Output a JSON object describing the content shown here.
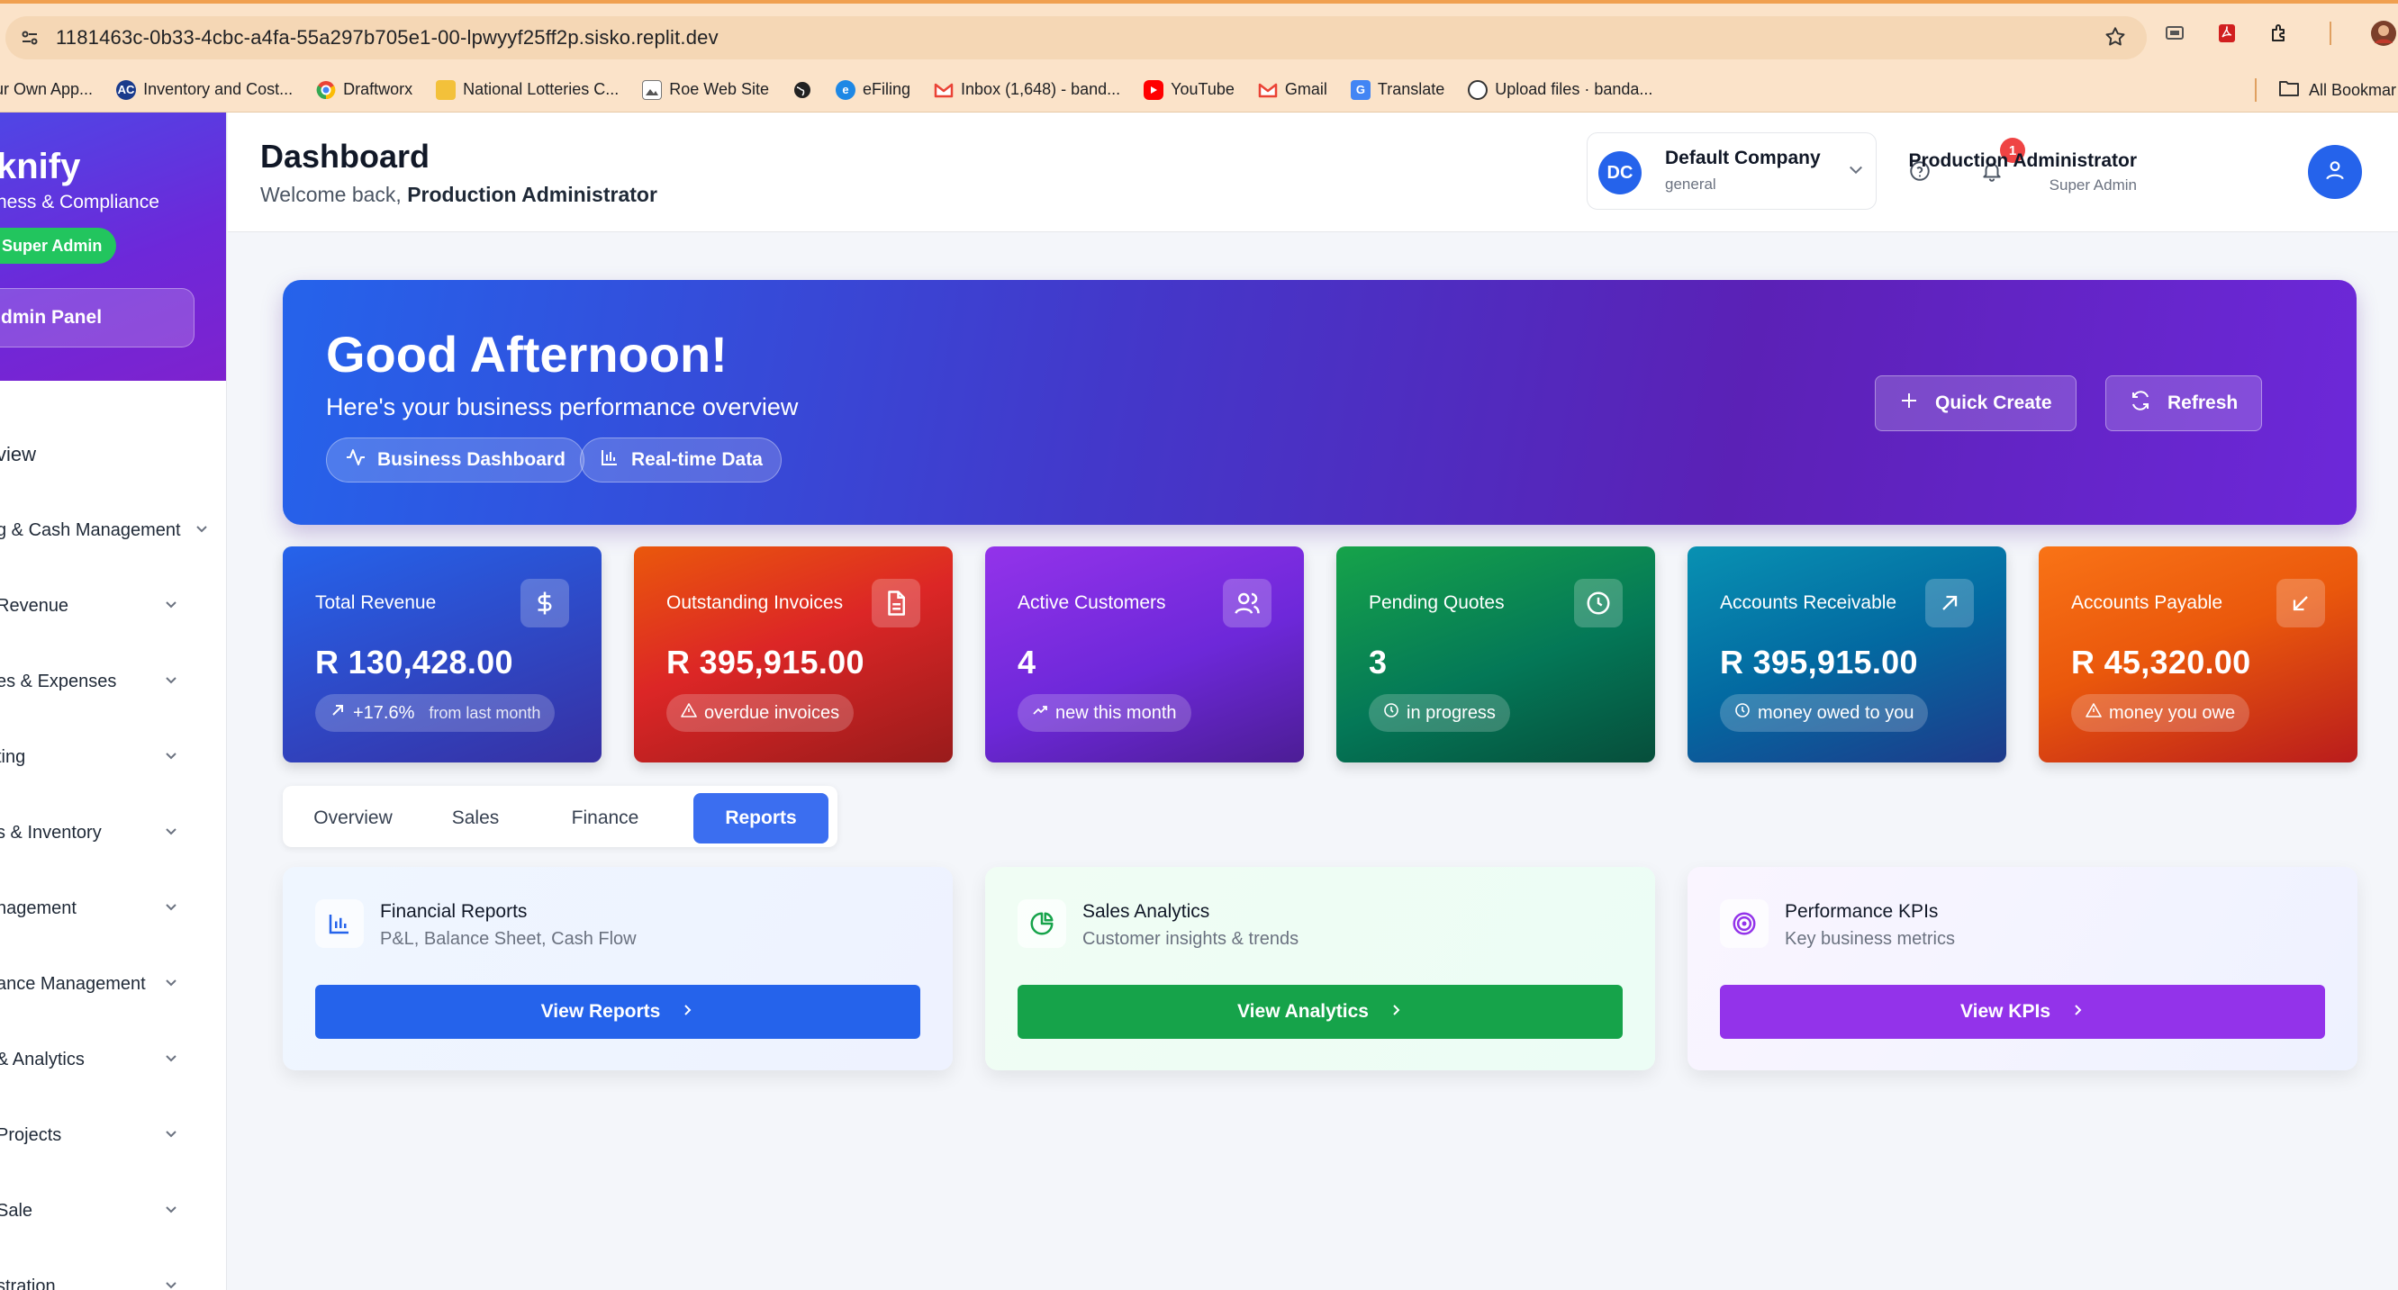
{
  "browser": {
    "url": "1181463c-0b33-4cbc-a4fa-55a297b705e1-00-lpwyyf25ff2p.sisko.replit.dev",
    "bookmarks": [
      {
        "label": "ur Own App...",
        "icon": "app-icon"
      },
      {
        "label": "Inventory and Cost...",
        "icon": "ac-icon"
      },
      {
        "label": "Draftworx",
        "icon": "chrome-icon"
      },
      {
        "label": "National Lotteries C...",
        "icon": "lotteries-icon"
      },
      {
        "label": "Roe Web Site",
        "icon": "image-icon"
      },
      {
        "label": "",
        "icon": "globe-icon"
      },
      {
        "label": "eFiling",
        "icon": "efiling-icon"
      },
      {
        "label": "Inbox (1,648) - band...",
        "icon": "gmail-icon"
      },
      {
        "label": "YouTube",
        "icon": "youtube-icon"
      },
      {
        "label": "Gmail",
        "icon": "gmail-icon"
      },
      {
        "label": "Translate",
        "icon": "translate-icon"
      },
      {
        "label": "Upload files · banda...",
        "icon": "github-icon"
      }
    ],
    "all_bookmarks": "All Bookmar"
  },
  "sidebar": {
    "brand": "knify",
    "tagline": "ness & Compliance",
    "role_badge": "Super Admin",
    "admin_panel": "dmin Panel",
    "items": [
      {
        "label": "view"
      },
      {
        "label": "g & Cash Management"
      },
      {
        "label": "Revenue"
      },
      {
        "label": "es & Expenses"
      },
      {
        "label": "ting"
      },
      {
        "label": "s & Inventory"
      },
      {
        "label": "nagement"
      },
      {
        "label": "ance Management"
      },
      {
        "label": "& Analytics"
      },
      {
        "label": "Projects"
      },
      {
        "label": "Sale"
      },
      {
        "label": "stration"
      }
    ]
  },
  "header": {
    "title": "Dashboard",
    "welcome_prefix": "Welcome back,",
    "welcome_name": "Production Administrator",
    "company": {
      "initials": "DC",
      "name": "Default Company",
      "type": "general"
    },
    "notifications": "1",
    "user": {
      "name": "Production Administrator",
      "role": "Super Admin"
    }
  },
  "hero": {
    "title": "Good Afternoon!",
    "subtitle": "Here's your business performance overview",
    "chips": [
      "Business Dashboard",
      "Real-time Data"
    ],
    "quick_create": "Quick Create",
    "refresh": "Refresh"
  },
  "stats": [
    {
      "label": "Total Revenue",
      "value": "R 130,428.00",
      "note": "+17.6%",
      "note_extra": "from last month",
      "icon": "dollar-icon",
      "color": "#2563eb"
    },
    {
      "label": "Outstanding Invoices",
      "value": "R 395,915.00",
      "note": "overdue invoices",
      "icon": "document-icon",
      "color": "#dc2626"
    },
    {
      "label": "Active Customers",
      "value": "4",
      "note": "new this month",
      "icon": "users-icon",
      "color": "#7c3aed"
    },
    {
      "label": "Pending Quotes",
      "value": "3",
      "note": "in progress",
      "icon": "clock-icon",
      "color": "#059669"
    },
    {
      "label": "Accounts Receivable",
      "value": "R 395,915.00",
      "note": "money owed to you",
      "icon": "arrow-up-right-icon",
      "color": "#0369a1"
    },
    {
      "label": "Accounts Payable",
      "value": "R 45,320.00",
      "note": "money you owe",
      "icon": "arrow-down-left-icon",
      "color": "#ea580c"
    }
  ],
  "tabs": [
    "Overview",
    "Sales",
    "Finance",
    "Reports"
  ],
  "active_tab": "Reports",
  "reports": [
    {
      "title": "Financial Reports",
      "subtitle": "P&L, Balance Sheet, Cash Flow",
      "button": "View Reports",
      "icon": "bar-chart-icon",
      "color": "#2563eb"
    },
    {
      "title": "Sales Analytics",
      "subtitle": "Customer insights & trends",
      "button": "View Analytics",
      "icon": "pie-chart-icon",
      "color": "#16a34a"
    },
    {
      "title": "Performance KPIs",
      "subtitle": "Key business metrics",
      "button": "View KPIs",
      "icon": "target-icon",
      "color": "#9333ea"
    }
  ]
}
